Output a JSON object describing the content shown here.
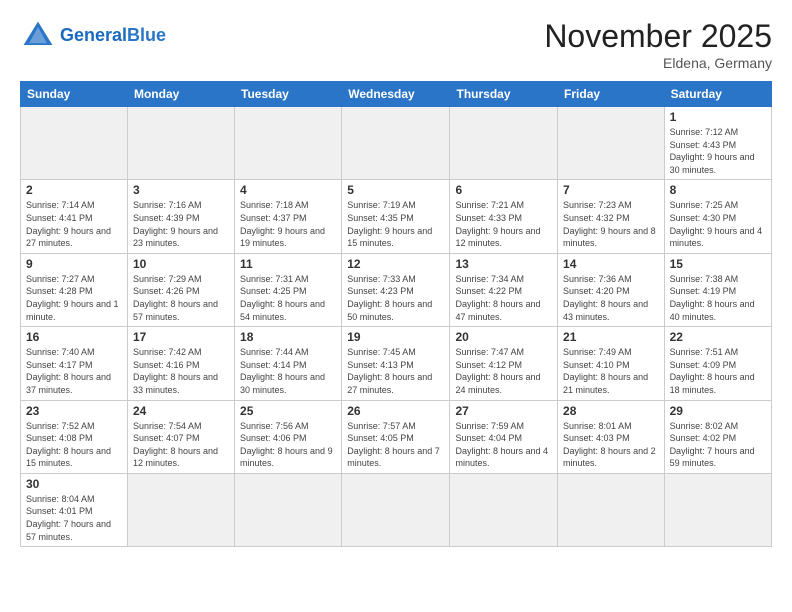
{
  "logo": {
    "general": "General",
    "blue": "Blue"
  },
  "header": {
    "month": "November 2025",
    "location": "Eldena, Germany"
  },
  "weekdays": [
    "Sunday",
    "Monday",
    "Tuesday",
    "Wednesday",
    "Thursday",
    "Friday",
    "Saturday"
  ],
  "weeks": [
    [
      {
        "day": "",
        "empty": true
      },
      {
        "day": "",
        "empty": true
      },
      {
        "day": "",
        "empty": true
      },
      {
        "day": "",
        "empty": true
      },
      {
        "day": "",
        "empty": true
      },
      {
        "day": "",
        "empty": true
      },
      {
        "day": "1",
        "sunrise": "7:12 AM",
        "sunset": "4:43 PM",
        "daylight": "9 hours and 30 minutes."
      }
    ],
    [
      {
        "day": "2",
        "sunrise": "7:14 AM",
        "sunset": "4:41 PM",
        "daylight": "9 hours and 27 minutes."
      },
      {
        "day": "3",
        "sunrise": "7:16 AM",
        "sunset": "4:39 PM",
        "daylight": "9 hours and 23 minutes."
      },
      {
        "day": "4",
        "sunrise": "7:18 AM",
        "sunset": "4:37 PM",
        "daylight": "9 hours and 19 minutes."
      },
      {
        "day": "5",
        "sunrise": "7:19 AM",
        "sunset": "4:35 PM",
        "daylight": "9 hours and 15 minutes."
      },
      {
        "day": "6",
        "sunrise": "7:21 AM",
        "sunset": "4:33 PM",
        "daylight": "9 hours and 12 minutes."
      },
      {
        "day": "7",
        "sunrise": "7:23 AM",
        "sunset": "4:32 PM",
        "daylight": "9 hours and 8 minutes."
      },
      {
        "day": "8",
        "sunrise": "7:25 AM",
        "sunset": "4:30 PM",
        "daylight": "9 hours and 4 minutes."
      }
    ],
    [
      {
        "day": "9",
        "sunrise": "7:27 AM",
        "sunset": "4:28 PM",
        "daylight": "9 hours and 1 minute."
      },
      {
        "day": "10",
        "sunrise": "7:29 AM",
        "sunset": "4:26 PM",
        "daylight": "8 hours and 57 minutes."
      },
      {
        "day": "11",
        "sunrise": "7:31 AM",
        "sunset": "4:25 PM",
        "daylight": "8 hours and 54 minutes."
      },
      {
        "day": "12",
        "sunrise": "7:33 AM",
        "sunset": "4:23 PM",
        "daylight": "8 hours and 50 minutes."
      },
      {
        "day": "13",
        "sunrise": "7:34 AM",
        "sunset": "4:22 PM",
        "daylight": "8 hours and 47 minutes."
      },
      {
        "day": "14",
        "sunrise": "7:36 AM",
        "sunset": "4:20 PM",
        "daylight": "8 hours and 43 minutes."
      },
      {
        "day": "15",
        "sunrise": "7:38 AM",
        "sunset": "4:19 PM",
        "daylight": "8 hours and 40 minutes."
      }
    ],
    [
      {
        "day": "16",
        "sunrise": "7:40 AM",
        "sunset": "4:17 PM",
        "daylight": "8 hours and 37 minutes."
      },
      {
        "day": "17",
        "sunrise": "7:42 AM",
        "sunset": "4:16 PM",
        "daylight": "8 hours and 33 minutes."
      },
      {
        "day": "18",
        "sunrise": "7:44 AM",
        "sunset": "4:14 PM",
        "daylight": "8 hours and 30 minutes."
      },
      {
        "day": "19",
        "sunrise": "7:45 AM",
        "sunset": "4:13 PM",
        "daylight": "8 hours and 27 minutes."
      },
      {
        "day": "20",
        "sunrise": "7:47 AM",
        "sunset": "4:12 PM",
        "daylight": "8 hours and 24 minutes."
      },
      {
        "day": "21",
        "sunrise": "7:49 AM",
        "sunset": "4:10 PM",
        "daylight": "8 hours and 21 minutes."
      },
      {
        "day": "22",
        "sunrise": "7:51 AM",
        "sunset": "4:09 PM",
        "daylight": "8 hours and 18 minutes."
      }
    ],
    [
      {
        "day": "23",
        "sunrise": "7:52 AM",
        "sunset": "4:08 PM",
        "daylight": "8 hours and 15 minutes."
      },
      {
        "day": "24",
        "sunrise": "7:54 AM",
        "sunset": "4:07 PM",
        "daylight": "8 hours and 12 minutes."
      },
      {
        "day": "25",
        "sunrise": "7:56 AM",
        "sunset": "4:06 PM",
        "daylight": "8 hours and 9 minutes."
      },
      {
        "day": "26",
        "sunrise": "7:57 AM",
        "sunset": "4:05 PM",
        "daylight": "8 hours and 7 minutes."
      },
      {
        "day": "27",
        "sunrise": "7:59 AM",
        "sunset": "4:04 PM",
        "daylight": "8 hours and 4 minutes."
      },
      {
        "day": "28",
        "sunrise": "8:01 AM",
        "sunset": "4:03 PM",
        "daylight": "8 hours and 2 minutes."
      },
      {
        "day": "29",
        "sunrise": "8:02 AM",
        "sunset": "4:02 PM",
        "daylight": "7 hours and 59 minutes."
      }
    ],
    [
      {
        "day": "30",
        "sunrise": "8:04 AM",
        "sunset": "4:01 PM",
        "daylight": "7 hours and 57 minutes."
      },
      {
        "day": "",
        "empty": true
      },
      {
        "day": "",
        "empty": true
      },
      {
        "day": "",
        "empty": true
      },
      {
        "day": "",
        "empty": true
      },
      {
        "day": "",
        "empty": true
      },
      {
        "day": "",
        "empty": true
      }
    ]
  ]
}
